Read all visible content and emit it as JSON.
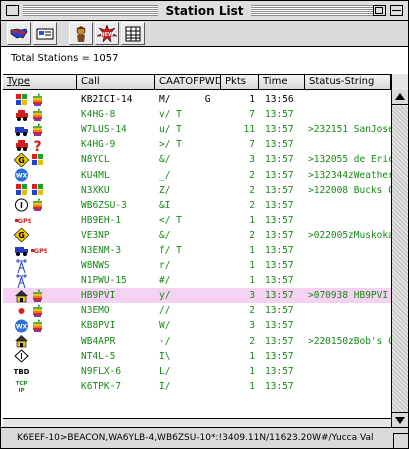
{
  "window": {
    "title": "Station List"
  },
  "toolbar": {
    "buttons": [
      {
        "name": "map",
        "icon": "usa-map-icon"
      },
      {
        "name": "info",
        "icon": "id-card-icon"
      },
      {
        "name": "station",
        "icon": "person-icon"
      },
      {
        "name": "new",
        "icon": "new-burst-icon"
      },
      {
        "name": "table",
        "icon": "table-icon"
      }
    ]
  },
  "summary": {
    "total_label": "Total Stations = 1057"
  },
  "columns": [
    "Type",
    "Call",
    "CAATOFPWDG",
    "Pkts",
    "Time",
    "Status-String"
  ],
  "colors": {
    "green": "#178a17",
    "selected": "#f6d2f2"
  },
  "rows": [
    {
      "icons": [
        "windows-icon",
        "apple-icon"
      ],
      "call": "KB2ICI-14",
      "flags": "M/      G",
      "pkts": "1",
      "time": "13:56",
      "status": "",
      "color": "black"
    },
    {
      "icons": [
        "car-icon",
        "apple-icon"
      ],
      "call": "K4HG-8",
      "flags": "v/ T",
      "pkts": "7",
      "time": "13:57",
      "status": "",
      "color": "green"
    },
    {
      "icons": [
        "truck-icon",
        "apple-icon"
      ],
      "call": "W7LUS-14",
      "flags": "u/ T",
      "pkts": "11",
      "time": "13:57",
      "status": ">232151 SanJose",
      "color": "green"
    },
    {
      "icons": [
        "car-icon",
        "question-icon"
      ],
      "call": "K4HG-9",
      "flags": ">/ T",
      "pkts": "7",
      "time": "13:57",
      "status": "",
      "color": "green"
    },
    {
      "icons": [
        "gate-icon",
        "windows-icon"
      ],
      "call": "N8YCL",
      "flags": "&/",
      "pkts": "3",
      "time": "13:57",
      "status": ">132055 de Eric",
      "color": "green"
    },
    {
      "icons": [
        "wx-icon"
      ],
      "call": "KU4ML",
      "flags": "_/",
      "pkts": "2",
      "time": "13:57",
      "status": ">132344zWeather",
      "color": "green"
    },
    {
      "icons": [
        "windows-icon",
        "windows-icon"
      ],
      "call": "N3XKU",
      "flags": "Z/",
      "pkts": "2",
      "time": "13:57",
      "status": ">122008 Bucks C",
      "color": "green"
    },
    {
      "icons": [
        "i-icon",
        "apple-icon"
      ],
      "call": "WB6ZSU-3",
      "flags": "&I",
      "pkts": "2",
      "time": "13:57",
      "status": "",
      "color": "green"
    },
    {
      "icons": [
        "gps-icon"
      ],
      "call": "HB9EH-1",
      "flags": "</ T",
      "pkts": "1",
      "time": "13:57",
      "status": "",
      "color": "green"
    },
    {
      "icons": [
        "gate-icon"
      ],
      "call": "VE3NP",
      "flags": "&/",
      "pkts": "2",
      "time": "13:57",
      "status": ">022005zMuskoka",
      "color": "green"
    },
    {
      "icons": [
        "truck-icon",
        "gps-icon"
      ],
      "call": "N3ENM-3",
      "flags": "f/ T",
      "pkts": "1",
      "time": "13:57",
      "status": "",
      "color": "green"
    },
    {
      "icons": [
        "tower-icon"
      ],
      "call": "W8NWS",
      "flags": "r/",
      "pkts": "1",
      "time": "13:57",
      "status": "",
      "color": "green"
    },
    {
      "icons": [
        "tower-icon"
      ],
      "call": "N1PWU-15",
      "flags": "#/",
      "pkts": "1",
      "time": "13:57",
      "status": "",
      "color": "green"
    },
    {
      "icons": [
        "house-icon",
        "apple-icon"
      ],
      "call": "HB9PVI",
      "flags": "y/",
      "pkts": "3",
      "time": "13:57",
      "status": ">070938 HB9PVI",
      "color": "green",
      "selected": true
    },
    {
      "icons": [
        "dot-icon",
        "apple-icon"
      ],
      "call": "N3EMO",
      "flags": "//",
      "pkts": "2",
      "time": "13:57",
      "status": "",
      "color": "green"
    },
    {
      "icons": [
        "wx-icon",
        "apple-icon"
      ],
      "call": "KB8PVI",
      "flags": "W/",
      "pkts": "3",
      "time": "13:57",
      "status": "",
      "color": "green"
    },
    {
      "icons": [
        "house-icon"
      ],
      "call": "WB4APR",
      "flags": "-/",
      "pkts": "2",
      "time": "13:57",
      "status": ">220150zBob's C",
      "color": "green"
    },
    {
      "icons": [
        "diamond-icon"
      ],
      "call": "NT4L-5",
      "flags": "I\\",
      "pkts": "1",
      "time": "13:57",
      "status": "",
      "color": "green"
    },
    {
      "icons": [
        "tbd-icon"
      ],
      "call": "N9FLX-6",
      "flags": "L/",
      "pkts": "1",
      "time": "13:57",
      "status": "",
      "color": "green"
    },
    {
      "icons": [
        "tcpip-icon"
      ],
      "call": "K6TPK-7",
      "flags": "I/",
      "pkts": "1",
      "time": "13:57",
      "status": "",
      "color": "green"
    }
  ],
  "statusbar": {
    "text": "K6EEF-10>BEACON,WA6YLB-4,WB6ZSU-10*:!3409.11N/11623.20W#/Yucca Val"
  }
}
